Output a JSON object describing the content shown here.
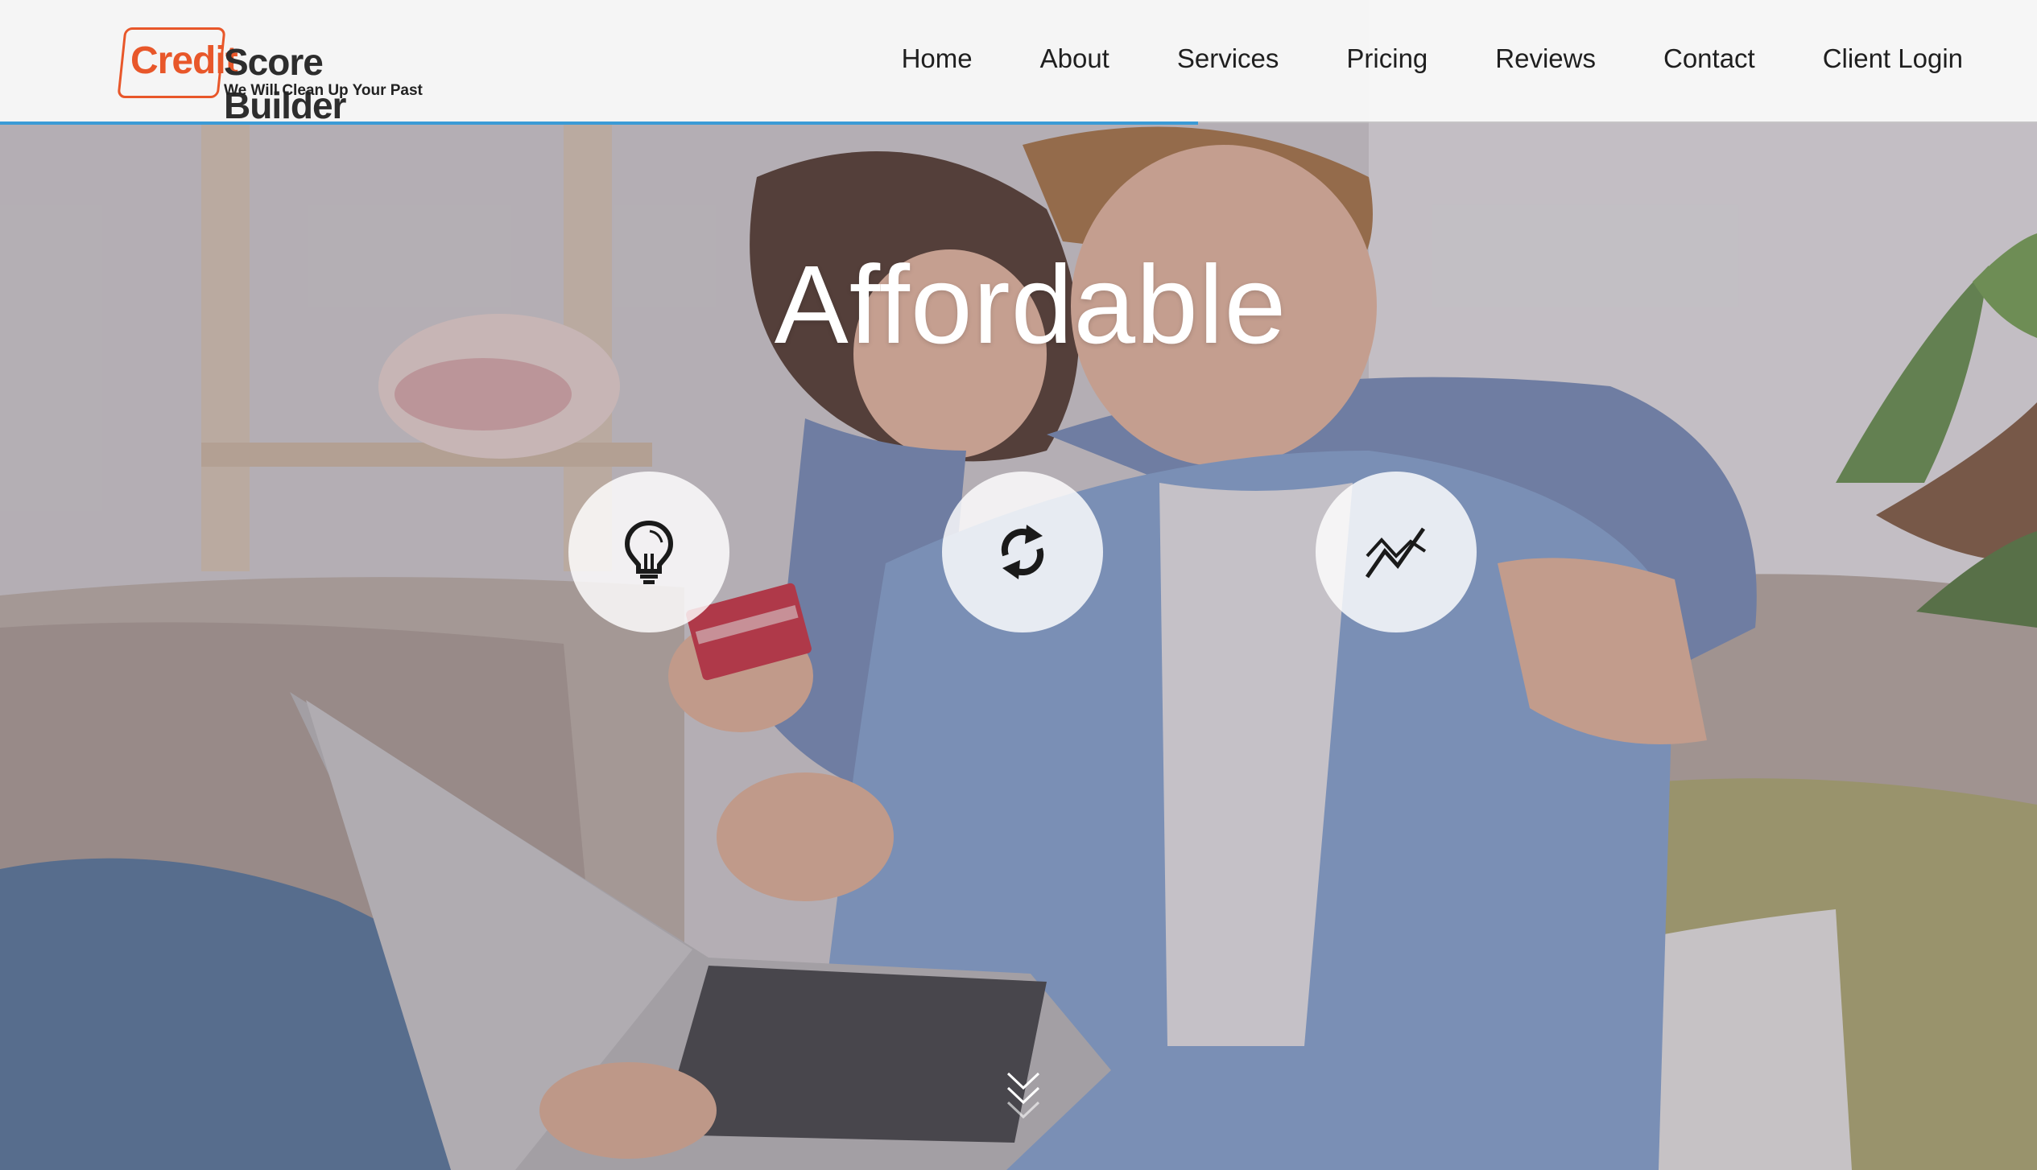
{
  "brand": {
    "logo_credit": "Credit",
    "logo_rest": "Score Builder",
    "tagline": "We Will Clean Up Your Past",
    "accent_color": "#e8572a"
  },
  "nav": {
    "items": [
      "Home",
      "About",
      "Services",
      "Pricing",
      "Reviews",
      "Contact",
      "Client Login"
    ]
  },
  "hero": {
    "title": "Affordable",
    "features": [
      {
        "icon": "lightbulb-icon"
      },
      {
        "icon": "refresh-icon"
      },
      {
        "icon": "trend-chart-icon"
      }
    ],
    "scroll_icon": "double-chevron-down-icon"
  },
  "colors": {
    "header_bg": "#f8f8f8",
    "header_line": "#3b9bd6",
    "title": "#ffffff"
  }
}
